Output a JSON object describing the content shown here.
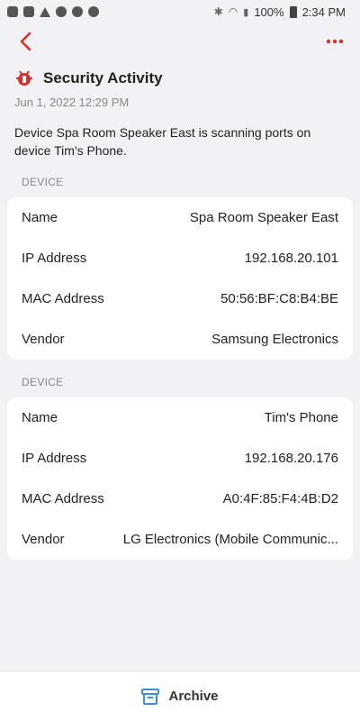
{
  "status_bar": {
    "battery": "100%",
    "time": "2:34 PM"
  },
  "header": {
    "title": "Security Activity",
    "timestamp": "Jun 1, 2022 12:29 PM",
    "description": "Device Spa Room Speaker East is scanning ports on device Tim's Phone."
  },
  "devices": [
    {
      "section_label": "DEVICE",
      "rows": [
        {
          "label": "Name",
          "value": "Spa Room Speaker East"
        },
        {
          "label": "IP Address",
          "value": "192.168.20.101"
        },
        {
          "label": "MAC Address",
          "value": "50:56:BF:C8:B4:BE"
        },
        {
          "label": "Vendor",
          "value": "Samsung Electronics"
        }
      ]
    },
    {
      "section_label": "DEVICE",
      "rows": [
        {
          "label": "Name",
          "value": "Tim's Phone"
        },
        {
          "label": "IP Address",
          "value": "192.168.20.176"
        },
        {
          "label": "MAC Address",
          "value": "A0:4F:85:F4:4B:D2"
        },
        {
          "label": "Vendor",
          "value": "LG Electronics (Mobile Communic..."
        }
      ]
    }
  ],
  "bottom": {
    "archive_label": "Archive"
  },
  "icons": {
    "back": "chevron-left-icon",
    "more": "more-dots-icon",
    "security": "bug-icon",
    "archive": "archive-icon"
  },
  "colors": {
    "accent": "#d32f2f",
    "archive_icon": "#3b8fe0"
  }
}
